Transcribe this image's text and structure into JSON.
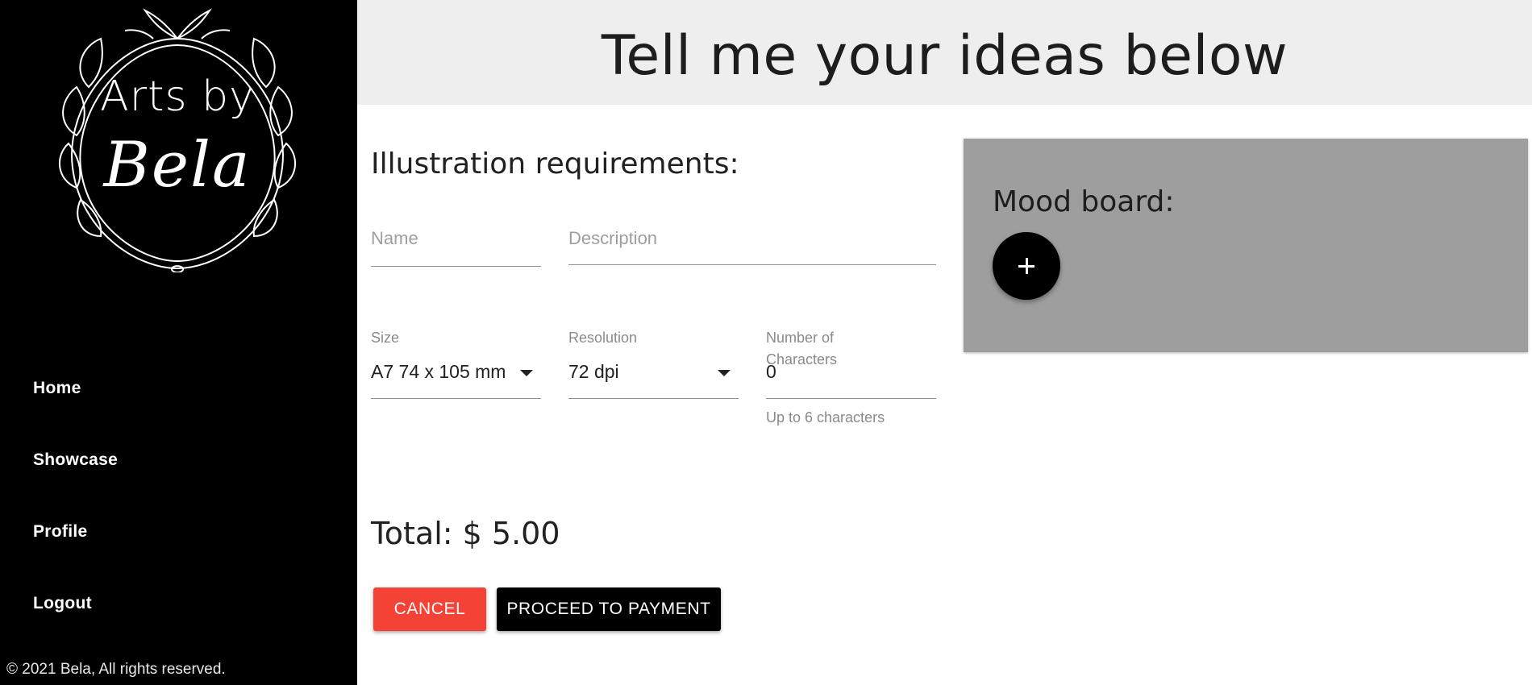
{
  "brand": {
    "logo_line1": "Arts by",
    "logo_line2": "Bela"
  },
  "sidebar": {
    "nav": [
      {
        "label": "Home"
      },
      {
        "label": "Showcase"
      },
      {
        "label": "Profile"
      },
      {
        "label": "Logout"
      }
    ],
    "copyright": "© 2021 Bela, All rights reserved."
  },
  "header": {
    "title": "Tell me your ideas below"
  },
  "form": {
    "title": "Illustration requirements:",
    "name_placeholder": "Name",
    "description_placeholder": "Description",
    "size": {
      "label": "Size",
      "value": "A7 74 x 105 mm"
    },
    "resolution": {
      "label": "Resolution",
      "value": "72 dpi"
    },
    "characters": {
      "label": "Number of Characters",
      "value": "0",
      "helper": "Up to 6 characters"
    },
    "total_label": "Total:",
    "total_value": "$ 5.00",
    "cancel_label": "CANCEL",
    "pay_label": "PROCEED TO PAYMENT"
  },
  "moodboard": {
    "title": "Mood board:",
    "add_icon": "plus-icon"
  },
  "colors": {
    "sidebar_bg": "#000000",
    "header_bg": "#eeeeee",
    "cancel_bg": "#f44336",
    "pay_bg": "#000000",
    "moodboard_bg": "#9e9e9e"
  }
}
